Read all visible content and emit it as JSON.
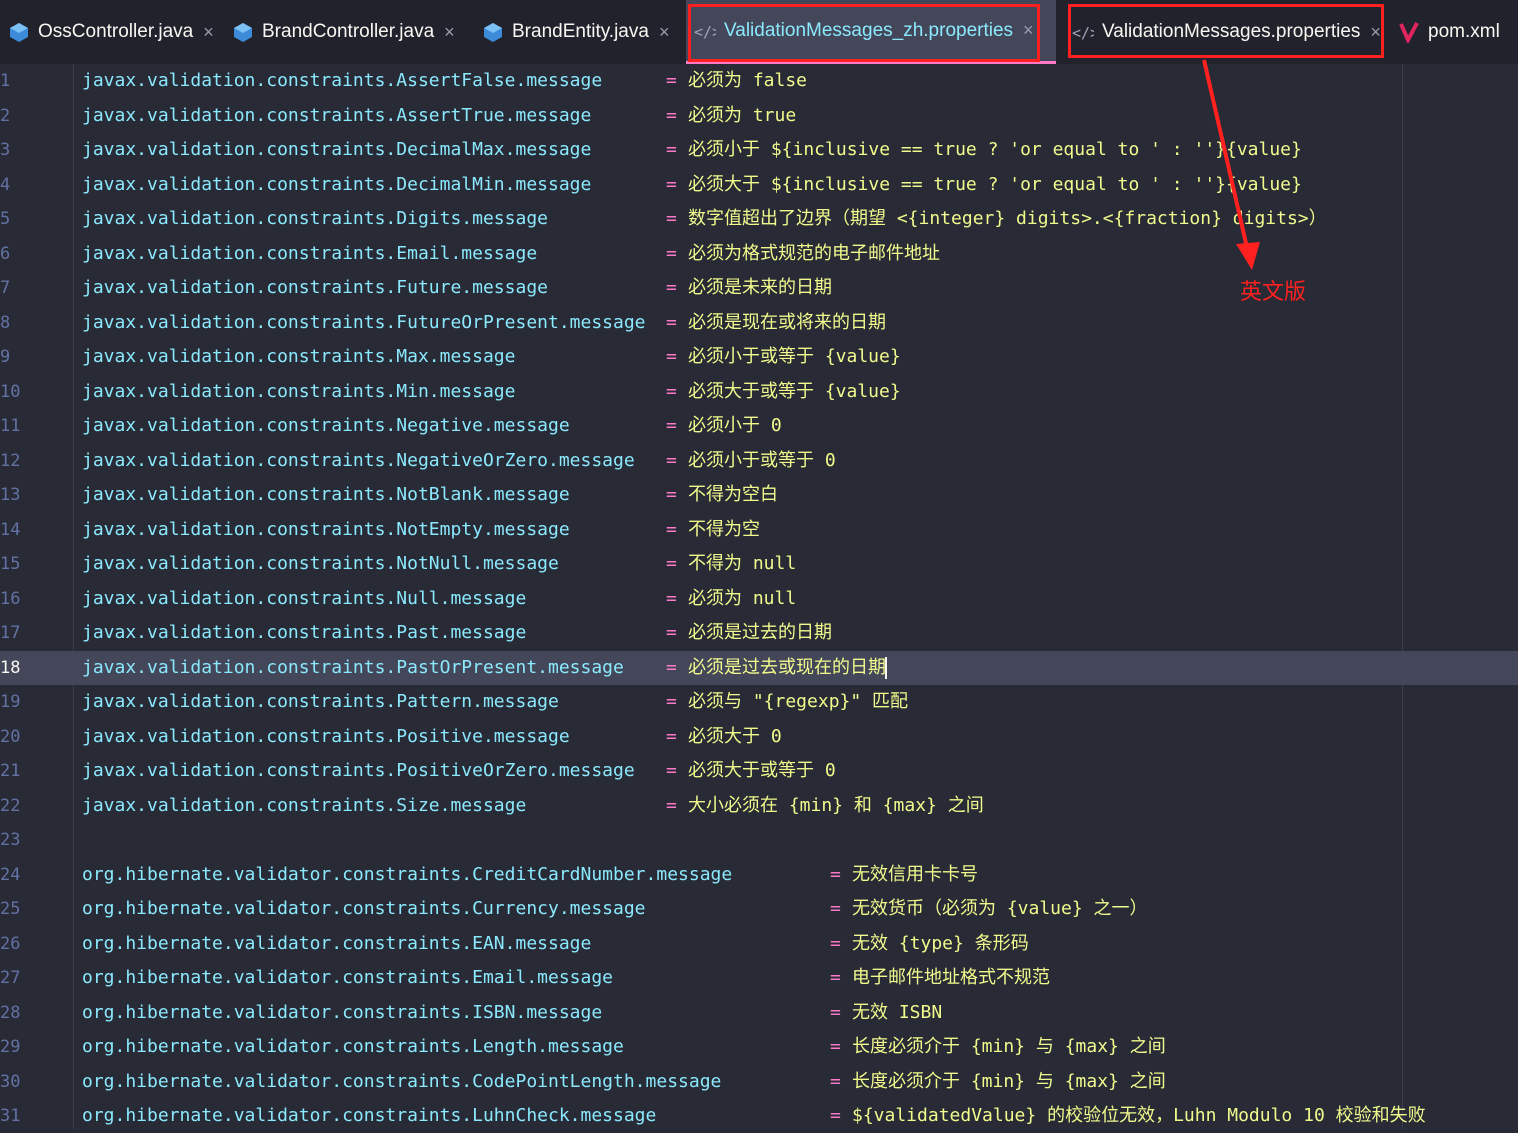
{
  "tabs": [
    {
      "label": "OssController.java",
      "icon": "java-class-icon",
      "active": false
    },
    {
      "label": "BrandController.java",
      "icon": "java-class-icon",
      "active": false
    },
    {
      "label": "BrandEntity.java",
      "icon": "java-class-icon",
      "active": false
    },
    {
      "label": "ValidationMessages_zh.properties",
      "icon": "properties-file-icon",
      "active": true
    },
    {
      "label": "ValidationMessages.properties",
      "icon": "properties-file-icon",
      "active": false
    },
    {
      "label": "pom.xml",
      "icon": "maven-icon",
      "active": false
    }
  ],
  "close_glyph": "×",
  "annotation": {
    "label": "英文版",
    "color": "#ff2020"
  },
  "editor": {
    "current_line": 18,
    "eq": "=",
    "lines": [
      {
        "n": "1",
        "key": "javax.validation.constraints.AssertFalse.message",
        "value": "必须为 false"
      },
      {
        "n": "2",
        "key": "javax.validation.constraints.AssertTrue.message",
        "value": "必须为 true"
      },
      {
        "n": "3",
        "key": "javax.validation.constraints.DecimalMax.message",
        "value": "必须小于 ${inclusive == true ? 'or equal to ' : ''}{value}"
      },
      {
        "n": "4",
        "key": "javax.validation.constraints.DecimalMin.message",
        "value": "必须大于 ${inclusive == true ? 'or equal to ' : ''}{value}"
      },
      {
        "n": "5",
        "key": "javax.validation.constraints.Digits.message",
        "value": "数字值超出了边界（期望 <{integer} digits>.<{fraction} digits>）"
      },
      {
        "n": "6",
        "key": "javax.validation.constraints.Email.message",
        "value": "必须为格式规范的电子邮件地址"
      },
      {
        "n": "7",
        "key": "javax.validation.constraints.Future.message",
        "value": "必须是未来的日期"
      },
      {
        "n": "8",
        "key": "javax.validation.constraints.FutureOrPresent.message",
        "value": "必须是现在或将来的日期"
      },
      {
        "n": "9",
        "key": "javax.validation.constraints.Max.message",
        "value": "必须小于或等于 {value}"
      },
      {
        "n": "10",
        "key": "javax.validation.constraints.Min.message",
        "value": "必须大于或等于 {value}"
      },
      {
        "n": "11",
        "key": "javax.validation.constraints.Negative.message",
        "value": "必须小于 0"
      },
      {
        "n": "12",
        "key": "javax.validation.constraints.NegativeOrZero.message",
        "value": "必须小于或等于 0"
      },
      {
        "n": "13",
        "key": "javax.validation.constraints.NotBlank.message",
        "value": "不得为空白"
      },
      {
        "n": "14",
        "key": "javax.validation.constraints.NotEmpty.message",
        "value": "不得为空"
      },
      {
        "n": "15",
        "key": "javax.validation.constraints.NotNull.message",
        "value": "不得为 null"
      },
      {
        "n": "16",
        "key": "javax.validation.constraints.Null.message",
        "value": "必须为 null"
      },
      {
        "n": "17",
        "key": "javax.validation.constraints.Past.message",
        "value": "必须是过去的日期"
      },
      {
        "n": "18",
        "key": "javax.validation.constraints.PastOrPresent.message",
        "value": "必须是过去或现在的日期"
      },
      {
        "n": "19",
        "key": "javax.validation.constraints.Pattern.message",
        "value": "必须与 \"{regexp}\" 匹配"
      },
      {
        "n": "20",
        "key": "javax.validation.constraints.Positive.message",
        "value": "必须大于 0"
      },
      {
        "n": "21",
        "key": "javax.validation.constraints.PositiveOrZero.message",
        "value": "必须大于或等于 0"
      },
      {
        "n": "22",
        "key": "javax.validation.constraints.Size.message",
        "value": "大小必须在 {min} 和 {max} 之间"
      },
      {
        "n": "23",
        "key": "",
        "value": ""
      },
      {
        "n": "24",
        "key": "org.hibernate.validator.constraints.CreditCardNumber.message",
        "value": "无效信用卡卡号"
      },
      {
        "n": "25",
        "key": "org.hibernate.validator.constraints.Currency.message",
        "value": "无效货币（必须为 {value} 之一）"
      },
      {
        "n": "26",
        "key": "org.hibernate.validator.constraints.EAN.message",
        "value": "无效 {type} 条形码"
      },
      {
        "n": "27",
        "key": "org.hibernate.validator.constraints.Email.message",
        "value": "电子邮件地址格式不规范"
      },
      {
        "n": "28",
        "key": "org.hibernate.validator.constraints.ISBN.message",
        "value": "无效 ISBN"
      },
      {
        "n": "29",
        "key": "org.hibernate.validator.constraints.Length.message",
        "value": "长度必须介于 {min} 与 {max} 之间"
      },
      {
        "n": "30",
        "key": "org.hibernate.validator.constraints.CodePointLength.message",
        "value": "长度必须介于 {min} 与 {max} 之间"
      },
      {
        "n": "31",
        "key": "org.hibernate.validator.constraints.LuhnCheck.message",
        "value": "${validatedValue} 的校验位无效，Luhn Modulo 10 校验和失败"
      }
    ]
  }
}
